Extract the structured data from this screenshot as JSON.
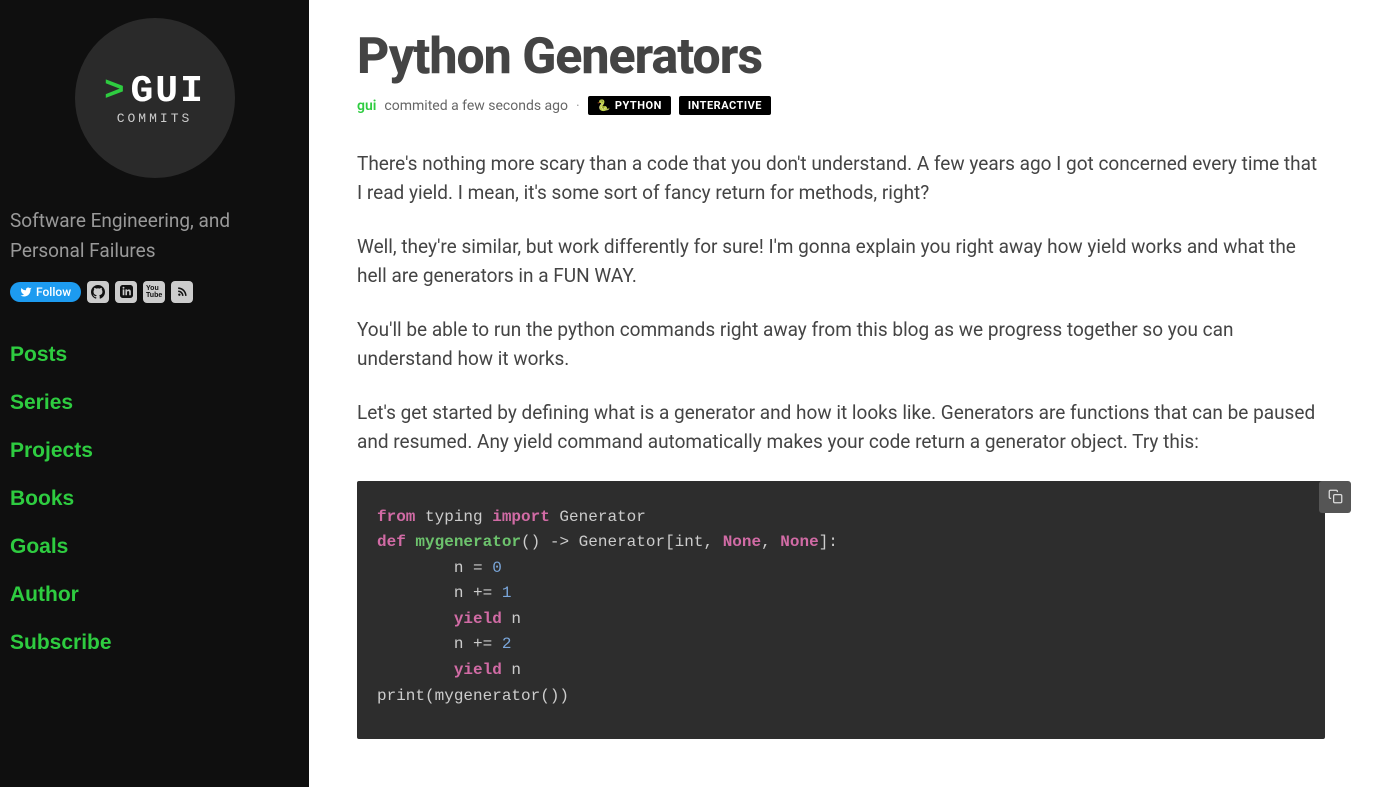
{
  "sidebar": {
    "logo": {
      "prompt": ">",
      "main": "GUI",
      "sub": "COMMITS"
    },
    "tagline": "Software Engineering, and Personal Failures",
    "twitter": "Follow",
    "nav": [
      "Posts",
      "Series",
      "Projects",
      "Books",
      "Goals",
      "Author",
      "Subscribe"
    ]
  },
  "article": {
    "title": "Python Generators",
    "author": "gui",
    "commit_text": "commited a few seconds ago",
    "tags": {
      "python": "PYTHON",
      "interactive": "INTERACTIVE"
    },
    "paragraphs": [
      "There's nothing more scary than a code that you don't understand. A few years ago I got concerned every time that I read yield. I mean, it's some sort of fancy return for methods, right?",
      "Well, they're similar, but work differently for sure! I'm gonna explain you right away how yield works and what the hell are generators in a FUN WAY.",
      "You'll be able to run the python commands right away from this blog as we progress together so you can understand how it works.",
      "Let's get started by defining what is a generator and how it looks like. Generators are functions that can be paused and resumed. Any yield command automatically makes your code return a generator object. Try this:"
    ],
    "code": {
      "l1a": "from",
      "l1b": " typing ",
      "l1c": "import",
      "l1d": " Generator",
      "l2": "",
      "l3a": "def",
      "l3b": " ",
      "l3c": "mygenerator",
      "l3d": "() -> Generator[int, ",
      "l3e": "None",
      "l3f": ", ",
      "l3g": "None",
      "l3h": "]:",
      "l4a": "        n = ",
      "l4b": "0",
      "l5a": "        n += ",
      "l5b": "1",
      "l6a": "        ",
      "l6b": "yield",
      "l6c": " n",
      "l7a": "        n += ",
      "l7b": "2",
      "l8a": "        ",
      "l8b": "yield",
      "l8c": " n",
      "l9": "",
      "l10": "print(mygenerator())"
    }
  }
}
